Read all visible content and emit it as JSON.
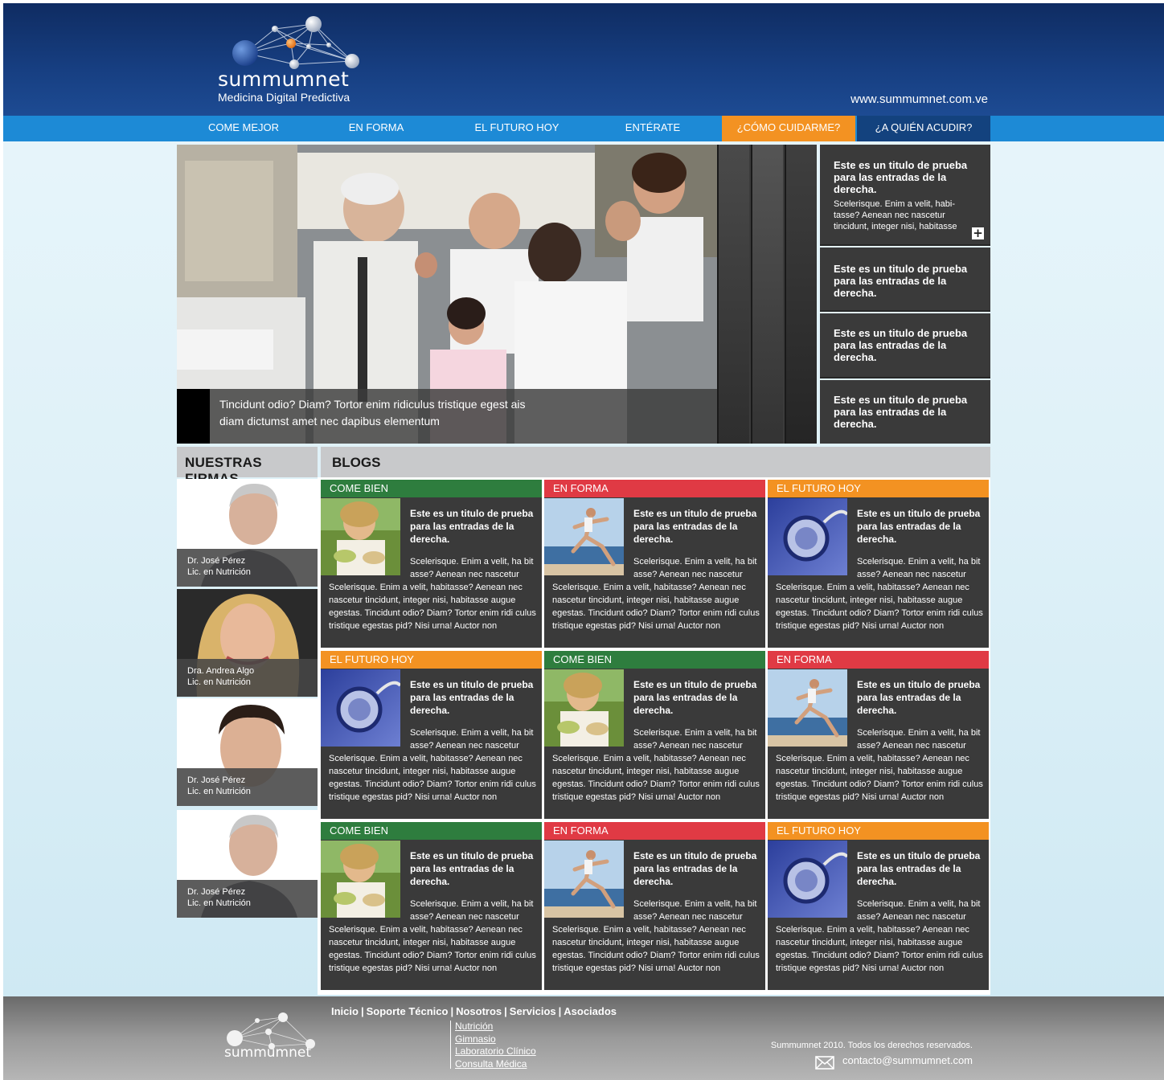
{
  "header": {
    "brand_name": "summumnet",
    "tagline": "Medicina Digital Predictiva",
    "site_url": "www.summumnet.com.ve"
  },
  "nav": {
    "items": [
      {
        "label": "COME MEJOR"
      },
      {
        "label": "EN FORMA"
      },
      {
        "label": "EL FUTURO HOY"
      },
      {
        "label": "ENTÉRATE"
      },
      {
        "label": "¿CÓMO CUIDARME?"
      },
      {
        "label": "¿A QUIÉN ACUDIR?"
      }
    ],
    "active_color": "#f39222",
    "bar_color": "#1d8ad6"
  },
  "hero": {
    "caption": "Tincidunt odio? Diam? Tortor enim ridiculus tristique egest ais diam dictumst amet nec dapibus elementum"
  },
  "side_posts": [
    {
      "title": "Este es un titulo de prueba para las entradas de la derecha.",
      "excerpt": "Scelerisque. Enim a velit, habi-tasse? Aenean nec nascetur tincidunt, integer nisi, habitasse",
      "icon": "plus-icon"
    },
    {
      "title": "Este es un titulo de prueba para las entradas de la derecha."
    },
    {
      "title": "Este es un titulo de prueba para las entradas de la derecha."
    },
    {
      "title": "Este es un titulo de prueba para las entradas de la derecha."
    }
  ],
  "firmas": {
    "title": "NUESTRAS FIRMAS",
    "people": [
      {
        "name": "Dr. José Pérez",
        "role": "Lic. en Nutrición"
      },
      {
        "name": "Dra. Andrea Algo",
        "role": "Lic. en Nutrición"
      },
      {
        "name": "Dr. José Pérez",
        "role": "Lic. en Nutrición"
      },
      {
        "name": "Dr. José Pérez",
        "role": "Lic. en Nutrición"
      }
    ]
  },
  "blogs": {
    "title": "BLOGS",
    "tag_colors": {
      "COME BIEN": "#2e7d3e",
      "EN FORMA": "#e03a44",
      "EL FUTURO HOY": "#f39222"
    },
    "cards": [
      {
        "tag": "COME BIEN",
        "thumb": "food-photo",
        "title": "Este es un titulo de prueba para las entradas de la derecha.",
        "excerpt_a": "Scelerisque. Enim a velit, ha bit asse? Aenean nec nascetur",
        "excerpt_b": "Scelerisque. Enim a velit,  habitasse? Aenean nec nascetur tincidunt, integer nisi, habitasse augue egestas. Tincidunt odio? Diam? Tortor enim ridi culus tristique egestas pid? Nisi urna! Auctor non"
      },
      {
        "tag": "EN FORMA",
        "thumb": "runner-photo",
        "title": "Este es un titulo de prueba para las entradas de la derecha.",
        "excerpt_a": "Scelerisque. Enim a velit, ha bit asse? Aenean nec nascetur",
        "excerpt_b": "Scelerisque. Enim a velit,  habitasse? Aenean nec nascetur tincidunt, integer nisi, habitasse augue egestas. Tincidunt odio? Diam? Tortor enim ridi culus tristique egestas pid? Nisi urna! Auctor non"
      },
      {
        "tag": "EL FUTURO HOY",
        "thumb": "stethoscope-photo",
        "title": "Este es un titulo de prueba para las entradas de la derecha.",
        "excerpt_a": "Scelerisque. Enim a velit, ha bit asse? Aenean nec nascetur",
        "excerpt_b": "Scelerisque. Enim a velit,  habitasse? Aenean nec nascetur tincidunt, integer nisi, habitasse augue egestas. Tincidunt odio? Diam? Tortor enim ridi culus tristique egestas pid? Nisi urna! Auctor non"
      },
      {
        "tag": "EL FUTURO HOY",
        "thumb": "stethoscope-photo",
        "title": "Este es un titulo de prueba para las entradas de la derecha.",
        "excerpt_a": "Scelerisque. Enim a velit, ha bit asse? Aenean nec nascetur",
        "excerpt_b": "Scelerisque. Enim a velit,  habitasse? Aenean nec nascetur tincidunt, integer nisi, habitasse augue egestas. Tincidunt odio? Diam? Tortor enim ridi culus tristique egestas pid? Nisi urna! Auctor non"
      },
      {
        "tag": "COME BIEN",
        "thumb": "food-photo",
        "title": "Este es un titulo de prueba para las entradas de la derecha.",
        "excerpt_a": "Scelerisque. Enim a velit, ha bit asse? Aenean nec nascetur",
        "excerpt_b": "Scelerisque. Enim a velit,  habitasse? Aenean nec nascetur tincidunt, integer nisi, habitasse augue egestas. Tincidunt odio? Diam? Tortor enim ridi culus tristique egestas pid? Nisi urna! Auctor non"
      },
      {
        "tag": "EN FORMA",
        "thumb": "runner-photo",
        "title": "Este es un titulo de prueba para las entradas de la derecha.",
        "excerpt_a": "Scelerisque. Enim a velit, ha bit asse? Aenean nec nascetur",
        "excerpt_b": "Scelerisque. Enim a velit,  habitasse? Aenean nec nascetur tincidunt, integer nisi, habitasse augue egestas. Tincidunt odio? Diam? Tortor enim ridi culus tristique egestas pid? Nisi urna! Auctor non"
      },
      {
        "tag": "COME BIEN",
        "thumb": "food-photo",
        "title": "Este es un titulo de prueba para las entradas de la derecha.",
        "excerpt_a": "Scelerisque. Enim a velit, ha bit asse? Aenean nec nascetur",
        "excerpt_b": "Scelerisque. Enim a velit,  habitasse? Aenean nec nascetur tincidunt, integer nisi, habitasse augue egestas. Tincidunt odio? Diam? Tortor enim ridi culus tristique egestas pid? Nisi urna! Auctor non"
      },
      {
        "tag": "EN FORMA",
        "thumb": "runner-photo",
        "title": "Este es un titulo de prueba para las entradas de la derecha.",
        "excerpt_a": "Scelerisque. Enim a velit, ha bit asse? Aenean nec nascetur",
        "excerpt_b": "Scelerisque. Enim a velit,  habitasse? Aenean nec nascetur tincidunt, integer nisi, habitasse augue egestas. Tincidunt odio? Diam? Tortor enim ridi culus tristique egestas pid? Nisi urna! Auctor non"
      },
      {
        "tag": "EL FUTURO HOY",
        "thumb": "stethoscope-photo",
        "title": "Este es un titulo de prueba para las entradas de la derecha.",
        "excerpt_a": "Scelerisque. Enim a velit, ha bit asse? Aenean nec nascetur",
        "excerpt_b": "Scelerisque. Enim a velit,  habitasse? Aenean nec nascetur tincidunt, integer nisi, habitasse augue egestas. Tincidunt odio? Diam? Tortor enim ridi culus tristique egestas pid? Nisi urna! Auctor non"
      }
    ]
  },
  "footer": {
    "brand_name": "summumnet",
    "links": [
      "Inicio",
      "Soporte Técnico",
      "Nosotros",
      "Servicios",
      "Asociados"
    ],
    "sublinks": [
      "Nutrición",
      "Gimnasio",
      "Laboratorio Clínico",
      "Consulta Médica"
    ],
    "copyright": "Summumnet 2010. Todos los derechos reservados.",
    "contact_email": "contacto@summumnet.com",
    "icon": "mail-icon"
  }
}
